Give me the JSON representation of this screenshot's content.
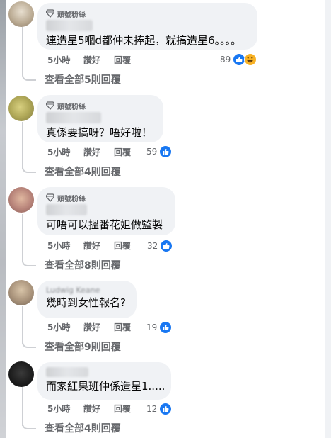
{
  "badge_label": "頭號粉絲",
  "comments": [
    {
      "text": "連造星5嗰d都仲未捧起，就搞造星6。。。。",
      "time": "5小時",
      "like": "讚好",
      "reply": "回覆",
      "reactions": "89",
      "view_replies": "查看全部5則回覆"
    },
    {
      "text": "真係要搞呀？唔好啦！",
      "time": "5小時",
      "like": "讚好",
      "reply": "回覆",
      "reactions": "59",
      "view_replies": "查看全部4則回覆"
    },
    {
      "text": "可唔可以搵番花姐做監製",
      "time": "5小時",
      "like": "讚好",
      "reply": "回覆",
      "reactions": "32",
      "view_replies": "查看全部8則回覆"
    },
    {
      "name": "Ludwig Keane",
      "text": "幾時到女性報名?",
      "time": "5小時",
      "like": "讚好",
      "reply": "回覆",
      "reactions": "19",
      "view_replies": "查看全部9則回覆"
    },
    {
      "text": "而家紅果班仲係造星1.....",
      "time": "5小時",
      "like": "讚好",
      "reply": "回覆",
      "reactions": "12",
      "view_replies": "查看全部4則回覆"
    }
  ],
  "colors": {
    "bubble": "#f0f2f5",
    "meta_text": "#65676b",
    "like_blue": "#1877f2",
    "haha_yellow": "#f7b125"
  },
  "icons": {
    "badge": "diamond-icon",
    "like": "thumbs-up-icon",
    "haha": "haha-emoji-icon"
  }
}
